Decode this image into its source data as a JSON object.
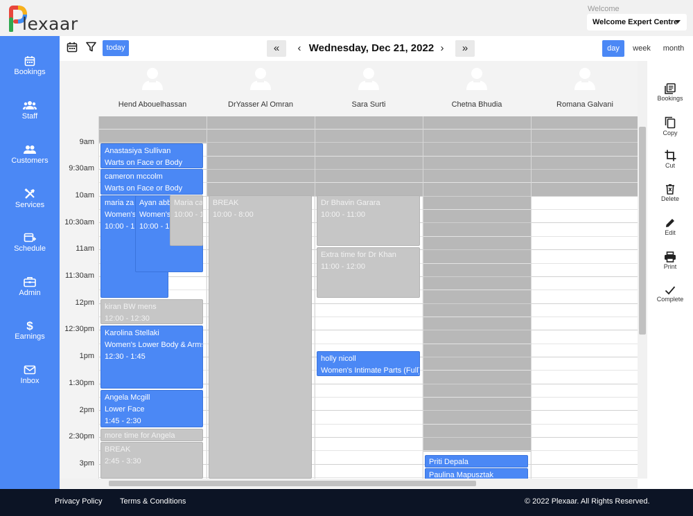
{
  "brand": {
    "logo_letter": "P",
    "logo_text": "lexaar"
  },
  "header": {
    "welcome_label": "Welcome",
    "account_name": "Welcome Expert Centre"
  },
  "sidebar": {
    "items": [
      {
        "label": "Bookings",
        "icon": "calendar-icon"
      },
      {
        "label": "Staff",
        "icon": "staff-icon"
      },
      {
        "label": "Customers",
        "icon": "customers-icon"
      },
      {
        "label": "Services",
        "icon": "tools-icon"
      },
      {
        "label": "Schedule",
        "icon": "schedule-icon"
      },
      {
        "label": "Admin",
        "icon": "briefcase-icon"
      },
      {
        "label": "Earnings",
        "icon": "dollar-icon"
      },
      {
        "label": "Inbox",
        "icon": "mail-icon"
      }
    ]
  },
  "toolbar": {
    "today_label": "today",
    "prev_fast": "«",
    "prev": "‹",
    "next": "›",
    "next_fast": "»",
    "date_title": "Wednesday, Dec 21, 2022",
    "views": {
      "day": "day",
      "week": "week",
      "month": "month"
    },
    "active_view": "day"
  },
  "resources": [
    "Hend Abouelhassan",
    "DrYasser Al Omran",
    "Sara Surti",
    "Chetna Bhudia",
    "Romana Galvani"
  ],
  "time_labels": [
    "9am",
    "9:30am",
    "10am",
    "10:30am",
    "11am",
    "11:30am",
    "12pm",
    "12:30pm",
    "1pm",
    "1:30pm",
    "2pm",
    "2:30pm",
    "3pm"
  ],
  "events": {
    "e1": {
      "line1": "Anastasiya Sullivan",
      "line2": "Warts on Face or Body"
    },
    "e2": {
      "line1": "cameron mccolm",
      "line2": "Warts on Face or Body"
    },
    "e3": {
      "line1": "maria za",
      "line2": "Women's",
      "line3": "10:00 - 1"
    },
    "e4": {
      "line1": "Ayan abb",
      "line2": "Women's",
      "line3": "10:00 - 1"
    },
    "e5": {
      "line1": "Maria ca",
      "line2": "10:00 - 1"
    },
    "e6": {
      "line1": "kiran BW mens",
      "line2": "12:00 - 12:30"
    },
    "e7": {
      "line1": "Karolina Stellaki",
      "line2": "Women's Lower Body & Arms",
      "line3": "12:30 - 1:45"
    },
    "e8": {
      "line1": "Angela Mcgill",
      "line2": "Lower Face",
      "line3": "1:45 - 2:30"
    },
    "e9": {
      "line1": "more time for Angela"
    },
    "e10": {
      "line1": "BREAK",
      "line2": "2:45 - 3:30"
    },
    "e11": {
      "line1": "BREAK",
      "line2": "10:00 - 8:00"
    },
    "e12": {
      "line1": "Dr Bhavin Garara",
      "line2": "10:00 - 11:00"
    },
    "e13": {
      "line1": "Extra time for Dr Khan",
      "line2": "11:00 - 12:00"
    },
    "e14": {
      "line1": "holly nicoll",
      "line2": "Women's Intimate Parts (Full)"
    },
    "e15": {
      "line1": "Priti Depala"
    },
    "e16": {
      "line1": "Paulina Mapusztak"
    }
  },
  "right_tools": [
    {
      "label": "Bookings",
      "icon": "bookings-list-icon"
    },
    {
      "label": "Copy",
      "icon": "copy-icon"
    },
    {
      "label": "Cut",
      "icon": "crop-icon"
    },
    {
      "label": "Delete",
      "icon": "trash-icon"
    },
    {
      "label": "Edit",
      "icon": "pencil-icon"
    },
    {
      "label": "Print",
      "icon": "printer-icon"
    },
    {
      "label": "Complete",
      "icon": "check-icon"
    }
  ],
  "footer": {
    "privacy": "Privacy Policy",
    "terms": "Terms & Conditions",
    "copyright": "© 2022 Plexaar. All Rights Reserved."
  },
  "colors": {
    "accent": "#4b88f5",
    "footer_bg": "#0c1425",
    "unavailable": "#b8b8b8"
  }
}
